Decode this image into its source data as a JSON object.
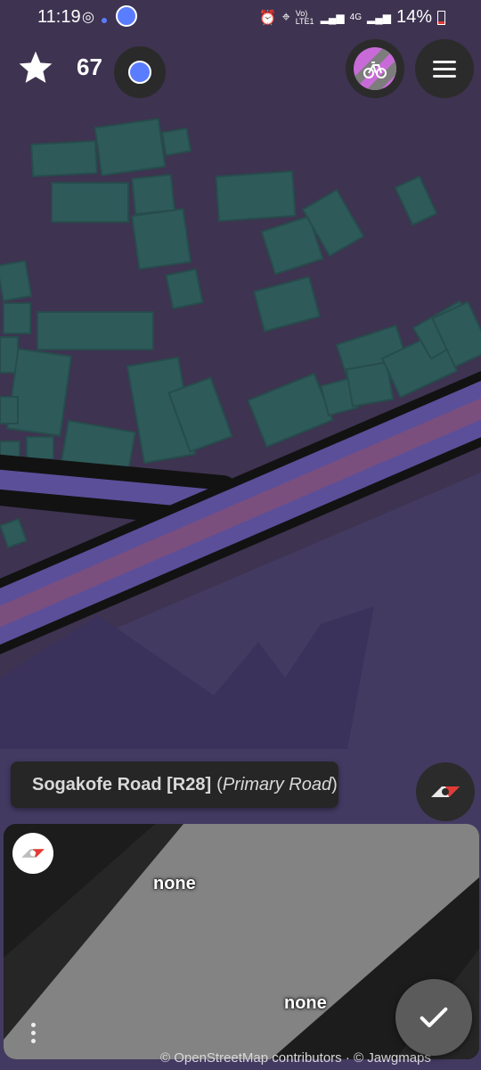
{
  "status_bar": {
    "time": "11:19",
    "network": "Vo) LTE1",
    "network_type": "4G",
    "battery": "14%"
  },
  "top_bar": {
    "star_count": "67",
    "icons": [
      "star-icon",
      "location-dot-icon",
      "bicycle-icon",
      "menu-icon"
    ]
  },
  "map": {
    "road_label": {
      "name": "Sogakofe Road [R28]",
      "type": "Primary Road"
    },
    "attribution": "© OpenStreetMap contributors · © Jawgmaps"
  },
  "panel": {
    "side_top_value": "none",
    "side_bottom_value": "none"
  },
  "colors": {
    "background": "#3e3350",
    "building": "#2e5a5a",
    "road_fill": "#5b4f9a",
    "road_center": "#7a4f7e",
    "accent_blue": "#5a7cff",
    "sign_red": "#e53935"
  }
}
